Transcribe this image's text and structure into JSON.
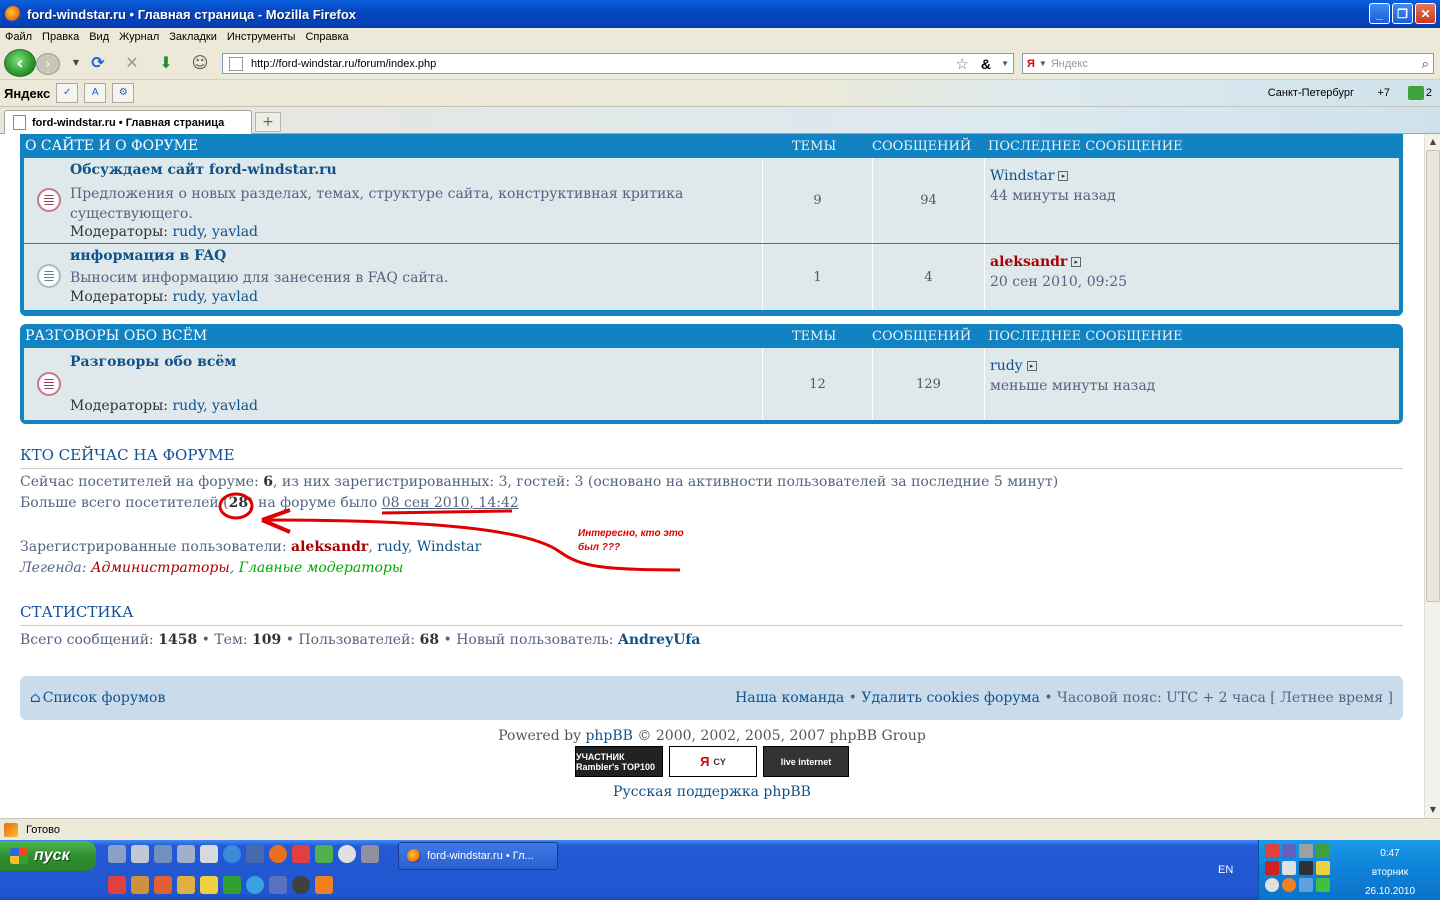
{
  "window": {
    "title": "ford-windstar.ru • Главная страница - Mozilla Firefox",
    "minimize": "_",
    "maximize": "❐",
    "close": "✕"
  },
  "menu": [
    "Файл",
    "Правка",
    "Вид",
    "Журнал",
    "Закладки",
    "Инструменты",
    "Справка"
  ],
  "navbar": {
    "url": "http://ford-windstar.ru/forum/index.php",
    "search_placeholder": "Яндекс",
    "search_engine": "Я"
  },
  "yabar": {
    "logo": "Яндекс",
    "city": "Санкт-Петербург",
    "temp": "+7",
    "mail_count": "2"
  },
  "tab": {
    "label": "ford-windstar.ru • Главная страница"
  },
  "forum": {
    "categories": [
      {
        "name": "О САЙТЕ И О ФОРУМЕ",
        "col_topics": "ТЕМЫ",
        "col_posts": "СООБЩЕНИЙ",
        "col_last": "ПОСЛЕДНЕЕ СООБЩЕНИЕ",
        "forums": [
          {
            "title": "Обсуждаем сайт ford-windstar.ru",
            "desc": "Предложения о новых разделах, темах, структуре сайта, конструктивная критика существующего.",
            "mods_label": "Модераторы:",
            "mods": "rudy, yavlad",
            "topics": "9",
            "posts": "94",
            "last_user": "Windstar",
            "last_time": "44 минуты назад"
          },
          {
            "title": "информация в FAQ",
            "desc": "Выносим информацию для занесения в FAQ сайта.",
            "mods_label": "Модераторы:",
            "mods": "rudy, yavlad",
            "topics": "1",
            "posts": "4",
            "last_user": "aleksandr",
            "last_time": "20 сен 2010, 09:25"
          }
        ]
      },
      {
        "name": "РАЗГОВОРЫ ОБО ВСЁМ",
        "col_topics": "ТЕМЫ",
        "col_posts": "СООБЩЕНИЙ",
        "col_last": "ПОСЛЕДНЕЕ СООБЩЕНИЕ",
        "forums": [
          {
            "title": "Разговоры обо всём",
            "desc": "",
            "mods_label": "Модераторы:",
            "mods": "rudy, yavlad",
            "topics": "12",
            "posts": "129",
            "last_user": "rudy",
            "last_time": "меньше минуты назад"
          }
        ]
      }
    ],
    "online": {
      "title": "КТО СЕЙЧАС НА ФОРУМЕ",
      "line1_pre": "Сейчас посетителей на форуме: ",
      "line1_count": "6",
      "line1_post": ", из них зарегистрированных: 3, гостей: 3 (основано на активности пользователей за последние 5 минут)",
      "line2_pre": "Больше всего посетителей (",
      "line2_count": "28",
      "line2_mid": ") на форуме было ",
      "line2_date": "08 сен 2010, 14:42",
      "reg_label": "Зарегистрированные пользователи: ",
      "reg_user1": "aleksandr",
      "reg_user2": "rudy",
      "reg_user3": "Windstar",
      "legend_label": "Легенда: ",
      "legend_admins": "Администраторы",
      "legend_gmods": "Главные модераторы"
    },
    "annotation": "Интересно, кто это был ???",
    "stats": {
      "title": "СТАТИСТИКА",
      "posts_label": "Всего сообщений: ",
      "posts": "1458",
      "topics_label": " • Тем: ",
      "topics": "109",
      "users_label": " • Пользователей: ",
      "users": "68",
      "newuser_label": " • Новый пользователь: ",
      "newuser": "AndreyUfa"
    },
    "footer": {
      "home": "Список форумов",
      "team": "Наша команда",
      "delete_cookies": "Удалить cookies форума",
      "timezone": "Часовой пояс: UTC + 2 часа [ Летнее время ]",
      "powered_pre": "Powered by ",
      "powered_link": "phpBB",
      "powered_post": " © 2000, 2002, 2005, 2007 phpBB Group",
      "support": "Русская поддержка phpBB",
      "counter1": "УЧАСТНИК Rambler's TOP100",
      "counter2": "CY",
      "counter3": "live internet"
    }
  },
  "status": "Готово",
  "taskbar": {
    "start": "пуск",
    "task": "ford-windstar.ru • Гл...",
    "lang": "EN",
    "time": "0:47",
    "day": "вторник",
    "date": "26.10.2010"
  }
}
